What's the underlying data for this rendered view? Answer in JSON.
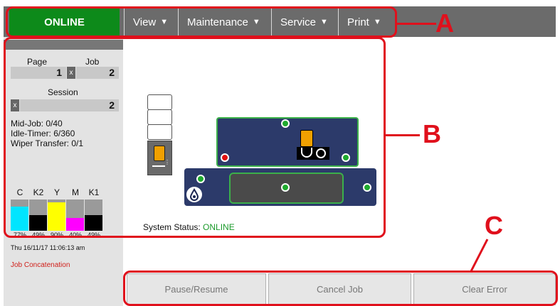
{
  "topbar": {
    "status": "ONLINE",
    "menus": [
      {
        "label": "View"
      },
      {
        "label": "Maintenance"
      },
      {
        "label": "Service"
      },
      {
        "label": "Print"
      }
    ]
  },
  "sidebar": {
    "page_label": "Page",
    "job_label": "Job",
    "page_count": "1",
    "job_count": "2",
    "session_label": "Session",
    "session_count": "2",
    "reset_symbol": "x",
    "mid_job": "Mid-Job: 0/40",
    "idle_timer": "Idle-Timer: 6/360",
    "wiper_transfer": "Wiper Transfer: 0/1",
    "inks": [
      {
        "label": "C",
        "percent_text": "77%",
        "level": 0.77,
        "color": "#00e5ff"
      },
      {
        "label": "K2",
        "percent_text": "49%",
        "level": 0.49,
        "color": "#000000"
      },
      {
        "label": "Y",
        "percent_text": "90%",
        "level": 0.9,
        "color": "#ffff00"
      },
      {
        "label": "M",
        "percent_text": "40%",
        "level": 0.4,
        "color": "#ff00ff"
      },
      {
        "label": "K1",
        "percent_text": "49%",
        "level": 0.49,
        "color": "#000000"
      }
    ],
    "timestamp": "Thu 16/11/17 11:06:13 am",
    "job_concatenation": "Job Concatenation"
  },
  "main": {
    "system_status_label": "System Status:",
    "system_status_value": "ONLINE"
  },
  "buttons": {
    "pause_resume": "Pause/Resume",
    "cancel_job": "Cancel Job",
    "clear_error": "Clear Error"
  },
  "annotations": {
    "a": "A",
    "b": "B",
    "c": "C",
    "color": "#e0101c"
  }
}
